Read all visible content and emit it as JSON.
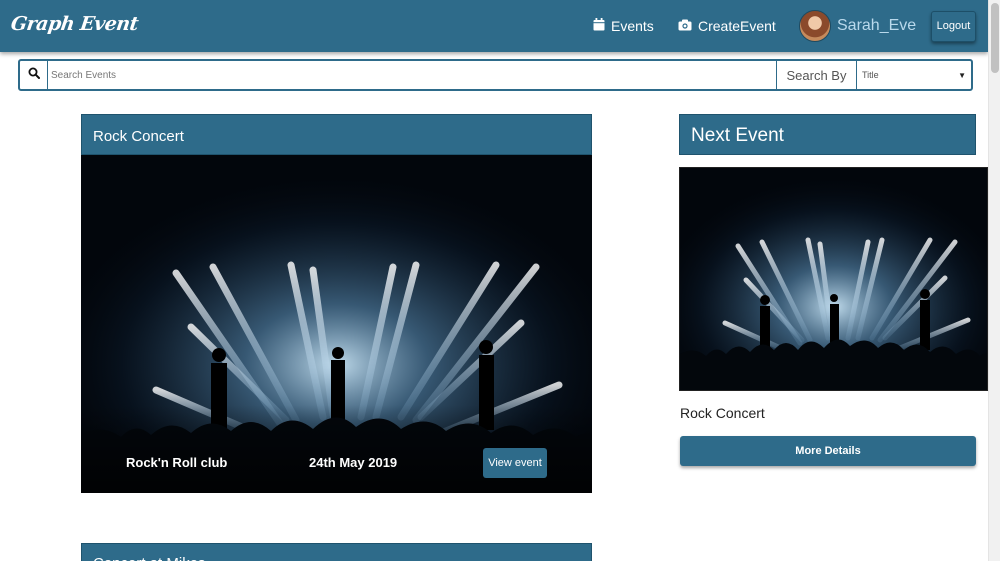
{
  "navbar": {
    "brand": "Graph Event",
    "events_label": "Events",
    "create_event_label": "CreateEvent",
    "username": "Sarah_Eve",
    "logout_label": "Logout"
  },
  "search": {
    "placeholder": "Search Events",
    "search_by_label": "Search By",
    "selected_option": "Title"
  },
  "events": [
    {
      "title": "Rock Concert",
      "venue": "Rock'n Roll club",
      "date": "24th May 2019",
      "view_label": "View event"
    },
    {
      "title": "Concert at Mikes"
    }
  ],
  "sidebar": {
    "heading": "Next Event",
    "event_title": "Rock Concert",
    "more_details_label": "More Details"
  },
  "colors": {
    "primary": "#2e6b8a",
    "username": "#b9d9ec"
  },
  "icons": [
    "calendar-icon",
    "camera-icon",
    "search-icon",
    "chevron-down-icon"
  ]
}
